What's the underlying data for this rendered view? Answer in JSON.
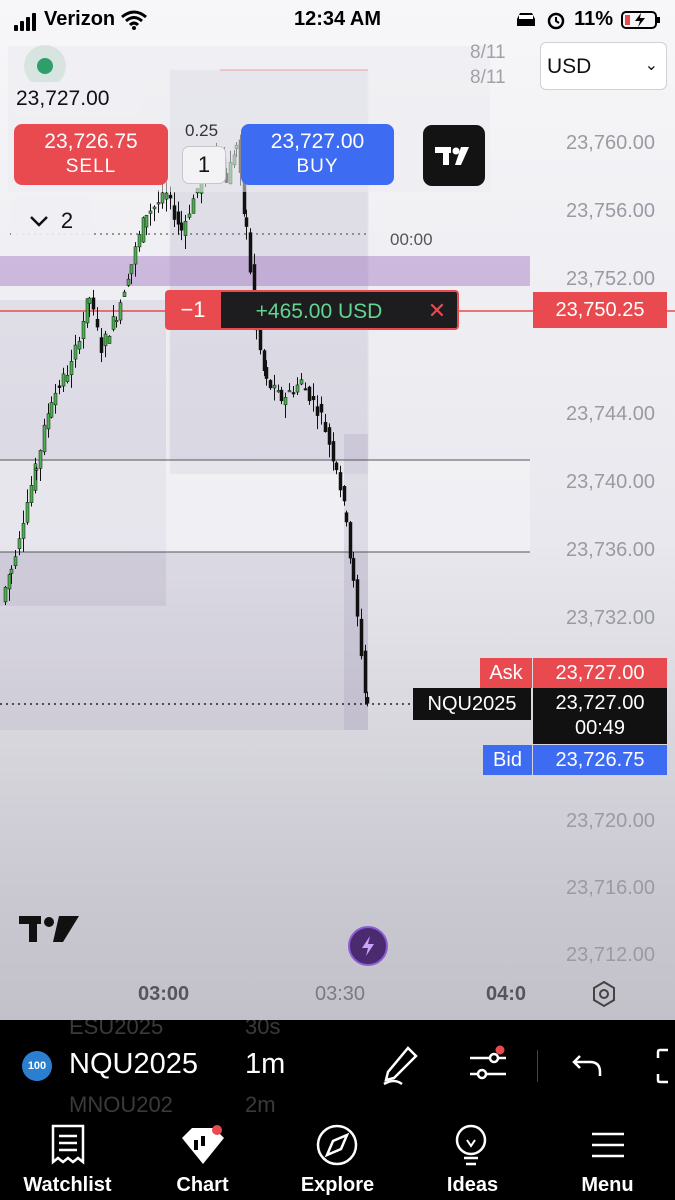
{
  "status_bar": {
    "carrier": "Verizon",
    "time": "12:34 AM",
    "battery": "11%"
  },
  "header": {
    "currency": "USD",
    "date_tag_1": "8/11",
    "date_tag_2": "8/11"
  },
  "trade_panel": {
    "last_price": "23,727.00",
    "sell_price": "23,726.75",
    "sell_label": "SELL",
    "buy_price": "23,727.00",
    "buy_label": "BUY",
    "qty": "1",
    "qty_step": "0.25",
    "collapse_count": "2"
  },
  "position": {
    "qty": "−1",
    "pnl": "+465.00 USD",
    "close": "✕",
    "price": "23,750.25"
  },
  "quotes": {
    "ask_label": "Ask",
    "ask_price": "23,727.00",
    "symbol": "NQU2025",
    "last_price": "23,727.00",
    "countdown": "00:49",
    "bid_label": "Bid",
    "bid_price": "23,726.75"
  },
  "chart_annotations": {
    "session_time": "00:00"
  },
  "price_axis": {
    "labels": [
      "23,760.00",
      "23,756.00",
      "23,752.00",
      "23,744.00",
      "23,740.00",
      "23,736.00",
      "23,732.00",
      "23,720.00",
      "23,716.00",
      "23,712.00"
    ]
  },
  "time_axis": {
    "labels": [
      "03:00",
      "03:30",
      "04:0"
    ]
  },
  "toolbar": {
    "badge": "100",
    "symbol": "NQU2025",
    "interval": "1m",
    "ghost_symbol_above": "ESU2025",
    "ghost_interval_above": "30s",
    "ghost_symbol_below": "MNQU202",
    "ghost_interval_below": "2m"
  },
  "tabs": [
    {
      "label": "Watchlist",
      "icon": "watchlist-icon"
    },
    {
      "label": "Chart",
      "icon": "chart-icon"
    },
    {
      "label": "Explore",
      "icon": "compass-icon"
    },
    {
      "label": "Ideas",
      "icon": "lightbulb-icon"
    },
    {
      "label": "Menu",
      "icon": "menu-icon"
    }
  ],
  "colors": {
    "sell": "#e84a4f",
    "buy": "#3d6cf2",
    "up_candle": "#4caf50",
    "down_candle": "#111111",
    "pnl_positive": "#62d58f"
  }
}
